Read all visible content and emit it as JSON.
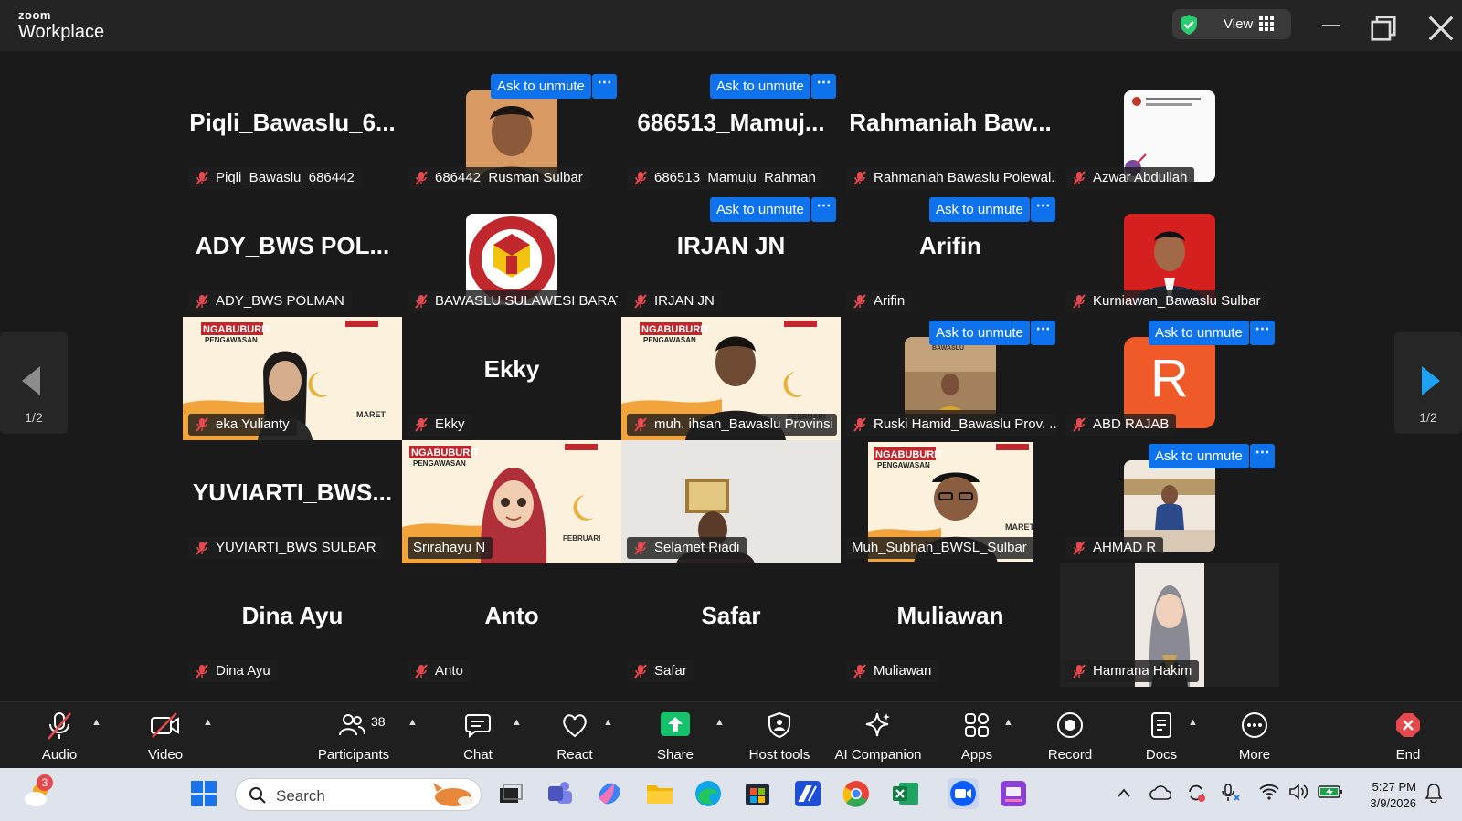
{
  "window": {
    "brand_top": "zoom",
    "brand_bottom": "Workplace",
    "view_label": "View"
  },
  "tiles": {
    "piqli": {
      "big": "Piqli_Bawaslu_6...",
      "name": "Piqli_Bawaslu_686442"
    },
    "rusman": {
      "name": "686442_Rusman Sulbar"
    },
    "rahman": {
      "big": "686513_Mamuj...",
      "name": "686513_Mamuju_Rahman"
    },
    "rahmaniah": {
      "big": "Rahmaniah  Baw...",
      "name": "Rahmaniah Bawaslu Polewal..."
    },
    "azwar": {
      "name": "Azwar Abdullah"
    },
    "ady": {
      "big": "ADY_BWS  POL...",
      "name": "ADY_BWS POLMAN"
    },
    "bawaslu_sb": {
      "name": "BAWASLU SULAWESI BARAT"
    },
    "irjan": {
      "big": "IRJAN JN",
      "name": "IRJAN JN"
    },
    "arifin": {
      "big": "Arifin",
      "name": "Arifin"
    },
    "kurniawan": {
      "name": "Kurniawan_Bawaslu Sulbar"
    },
    "eka": {
      "name": "eka Yulianty"
    },
    "ekky": {
      "big": "Ekky",
      "name": "Ekky"
    },
    "ihsan": {
      "name": "muh. ihsan_Bawaslu Provinsi"
    },
    "ruski": {
      "name": "Ruski Hamid_Bawaslu Prov. ..."
    },
    "abd": {
      "name": "ABD RAJAB",
      "avatar_letter": "R"
    },
    "yuviarti": {
      "big": "YUVIARTI_BWS...",
      "name": "YUVIARTI_BWS SULBAR"
    },
    "srirahayu": {
      "name": "Srirahayu N"
    },
    "selamet": {
      "name": "Selamet Riadi"
    },
    "subhan": {
      "name": "Muh_Subhan_BWSL_Sulbar"
    },
    "ahmad": {
      "name": "AHMAD R"
    },
    "dina": {
      "big": "Dina Ayu",
      "name": "Dina Ayu"
    },
    "anto": {
      "big": "Anto",
      "name": "Anto"
    },
    "safar": {
      "big": "Safar",
      "name": "Safar"
    },
    "muliawan": {
      "big": "Muliawan",
      "name": "Muliawan"
    },
    "hamrana": {
      "name": "Hamrana Hakim"
    }
  },
  "ask_label": "Ask to unmute",
  "more_label": "⋯",
  "pager": {
    "left": "1/2",
    "right": "1/2"
  },
  "toolbar": {
    "audio": "Audio",
    "video": "Video",
    "participants": "Participants",
    "participants_count": "38",
    "chat": "Chat",
    "react": "React",
    "share": "Share",
    "host_tools": "Host tools",
    "ai_companion": "AI Companion",
    "apps": "Apps",
    "record": "Record",
    "docs": "Docs",
    "more": "More",
    "end": "End"
  },
  "taskbar": {
    "weather_badge": "3",
    "search_placeholder": "Search",
    "time": "5:27 PM",
    "date": "3/9/2026"
  },
  "video_text": {
    "ngabuburit": "NGABUBURIT",
    "pengawasan": "PENGAWASAN",
    "maret": "MARET",
    "februari": "FEBRUARI",
    "bawaslu": "BAWASLU"
  },
  "colors": {
    "accent": "#0e72ed",
    "speaking": "#2ecc71",
    "mute": "#e5484d",
    "end": "#e5484d"
  }
}
